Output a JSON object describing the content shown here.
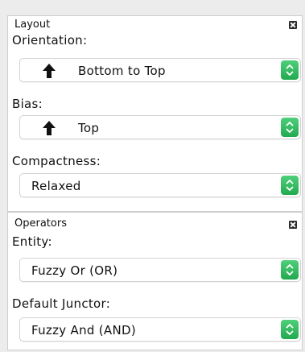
{
  "layout_panel": {
    "title": "Layout",
    "orientation": {
      "label": "Orientation:",
      "value": "Bottom to Top",
      "icon": "arrow-up-icon"
    },
    "bias": {
      "label": "Bias:",
      "value": "Top",
      "icon": "arrow-up-icon"
    },
    "compactness": {
      "label": "Compactness:",
      "value": "Relaxed"
    }
  },
  "operators_panel": {
    "title": "Operators",
    "entity": {
      "label": "Entity:",
      "value": "Fuzzy Or (OR)"
    },
    "default_junctor": {
      "label": "Default Junctor:",
      "value": "Fuzzy And (AND)"
    }
  },
  "colors": {
    "stepper_green": "#2fbd5e",
    "panel_bg": "#ffffff",
    "window_bg": "#ececec"
  }
}
